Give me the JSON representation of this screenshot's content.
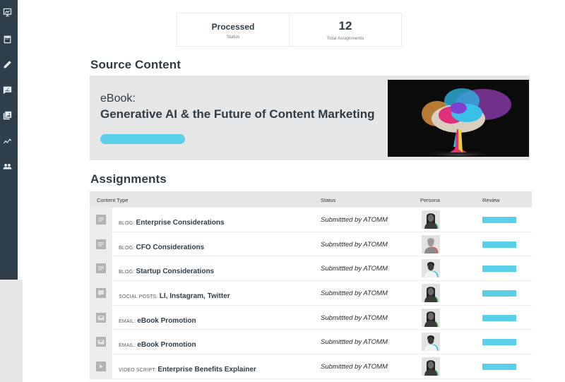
{
  "sidebar": {
    "items": [
      {
        "name": "presentation-icon"
      },
      {
        "name": "calendar-icon"
      },
      {
        "name": "pencil-icon"
      },
      {
        "name": "chat-edit-icon"
      },
      {
        "name": "image-gallery-icon"
      },
      {
        "name": "analytics-icon"
      },
      {
        "name": "users-icon"
      }
    ]
  },
  "stats": [
    {
      "value": "Processed",
      "label": "Status"
    },
    {
      "value": "12",
      "label": "Total Assignments"
    }
  ],
  "source": {
    "heading": "Source Content",
    "kind": "eBook:",
    "title": "Generative AI & the Future of Content Marketing",
    "image": "colorful-brain-tree-image"
  },
  "assignments": {
    "heading": "Assignments",
    "columns": [
      "Content Type",
      "Status",
      "Persona",
      "Review"
    ],
    "rows": [
      {
        "icon": "document-icon",
        "type": "Blog:",
        "name": "Enterprise Considerations",
        "status": "Submittted by ATOMM",
        "persona": "woman-green",
        "review_color": "#5bd0ea"
      },
      {
        "icon": "document-icon",
        "type": "Blog:",
        "name": "CFO Considerations",
        "status": "Submittted by ATOMM",
        "persona": "man-red",
        "review_color": "#5bd0ea"
      },
      {
        "icon": "document-icon",
        "type": "Blog:",
        "name": "Startup Considerations",
        "status": "Submittted by ATOMM",
        "persona": "man-blue",
        "review_color": "#5bd0ea"
      },
      {
        "icon": "social-post-icon",
        "type": "Social Posts:",
        "name": "LI, Instagram, Twitter",
        "status": "Submittted by ATOMM",
        "persona": "woman-green",
        "review_color": "#5bd0ea"
      },
      {
        "icon": "email-icon",
        "type": "Email:",
        "name": "eBook Promotion",
        "status": "Submittted by ATOMM",
        "persona": "woman-green",
        "review_color": "#5bd0ea"
      },
      {
        "icon": "email-icon",
        "type": "Email:",
        "name": "eBook Promotion",
        "status": "Submittted by ATOMM",
        "persona": "man-blue",
        "review_color": "#5bd0ea"
      },
      {
        "icon": "video-icon",
        "type": "Video Script:",
        "name": "Enterprise Benefits Explainer",
        "status": "Submittted by ATOMM",
        "persona": "woman-green",
        "review_color": "#5bd0ea"
      }
    ]
  },
  "colors": {
    "sidebar": "#2e3e4a",
    "accent": "#5bd0ea",
    "text": "#2f3d48"
  }
}
